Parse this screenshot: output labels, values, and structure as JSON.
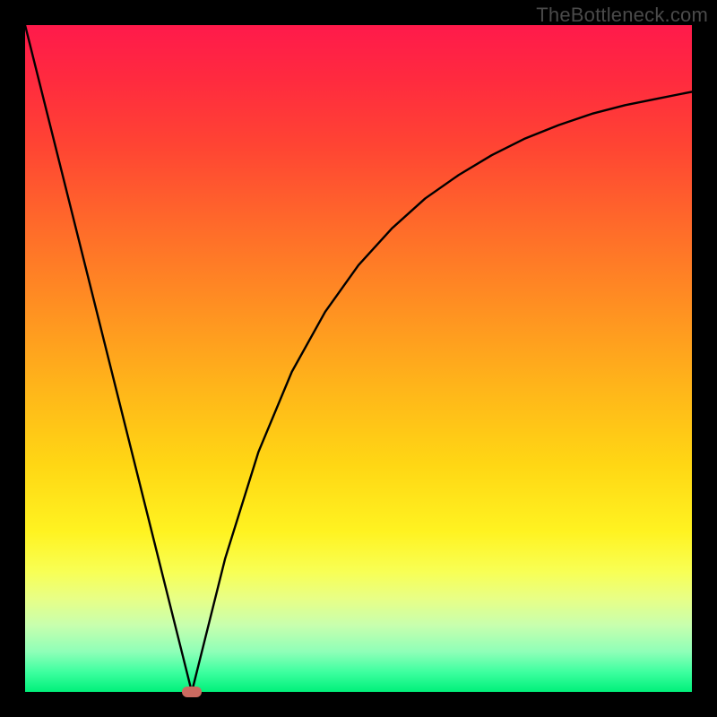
{
  "watermark": "TheBottleneck.com",
  "chart_data": {
    "type": "line",
    "title": "",
    "xlabel": "",
    "ylabel": "",
    "xlim": [
      0,
      100
    ],
    "ylim": [
      0,
      100
    ],
    "grid": false,
    "series": [
      {
        "name": "curve",
        "x": [
          0,
          5,
          10,
          15,
          20,
          24,
          25,
          26,
          30,
          35,
          40,
          45,
          50,
          55,
          60,
          65,
          70,
          75,
          80,
          85,
          90,
          95,
          100
        ],
        "y": [
          100,
          80,
          60,
          40,
          20,
          4,
          0,
          4,
          20,
          36,
          48,
          57,
          64,
          69.5,
          74,
          77.5,
          80.5,
          83,
          85,
          86.7,
          88,
          89,
          90
        ]
      }
    ],
    "marker": {
      "x": 25,
      "y": 0,
      "color": "#cb6a60"
    },
    "gradient_stops": [
      {
        "pos": 0,
        "color": "#ff1a4b"
      },
      {
        "pos": 100,
        "color": "#00f07a"
      }
    ]
  }
}
